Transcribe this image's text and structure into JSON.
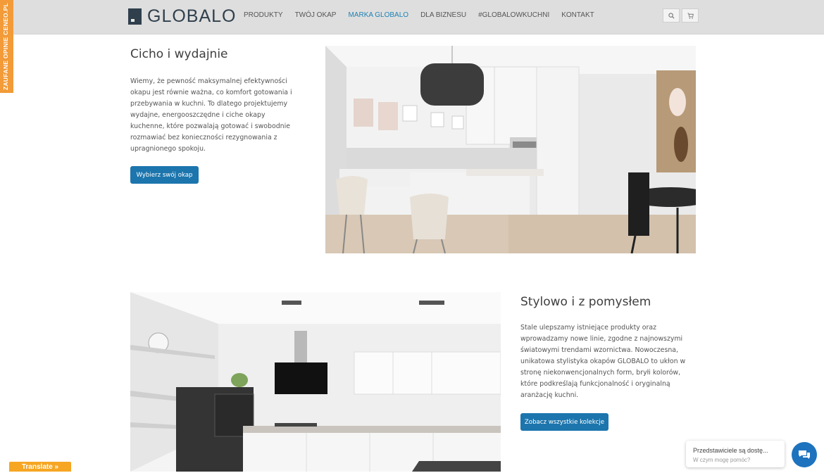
{
  "header": {
    "logo_text": "GLOBALO",
    "nav": [
      "PRODUKTY",
      "TWÓJ OKAP",
      "MARKA GLOBALO",
      "DLA BIZNESU",
      "#GLOBALOWKUCHNI",
      "KONTAKT"
    ],
    "active_nav": "MARKA GLOBALO",
    "icons": [
      "search-icon",
      "cart-icon"
    ]
  },
  "side_tab": {
    "label": "ZAUFANE OPINIE CENEO.PL"
  },
  "section1": {
    "title": "Cicho i wydajnie",
    "body": "Wiemy, że pewność maksymalnej efektywności okapu jest równie ważna, co komfort gotowania i przebywania w kuchni. To dlatego projektujemy wydajne, energooszczędne i ciche okapy kuchenne, które pozwalają gotować i swobodnie rozmawiać bez konieczności rezygnowania z upragnionego spokoju.",
    "button": "Wybierz swój okap"
  },
  "section2": {
    "title": "Stylowo i z pomysłem",
    "body": "Stale ulepszamy istniejące produkty oraz wprowadzamy nowe linie, zgodne z najnowszymi światowymi trendami wzornictwa. Nowoczesna, unikatowa stylistyka okapów GLOBALO to ukłon w stronę niekonwencjonalnych form, bryłi kolorów, które podkreślają funkcjonalność i oryginalną aranżację kuchni.",
    "button": "Zobacz wszystkie kolekcje"
  },
  "chat": {
    "title": "Przedstawiciele są dostę...",
    "subtitle": "W czym mogę pomóc?"
  },
  "translate": {
    "label": "Translate »"
  },
  "colors": {
    "accent": "#1c75ad",
    "nav_active": "#1e83b6",
    "orange": "#f29b38"
  }
}
